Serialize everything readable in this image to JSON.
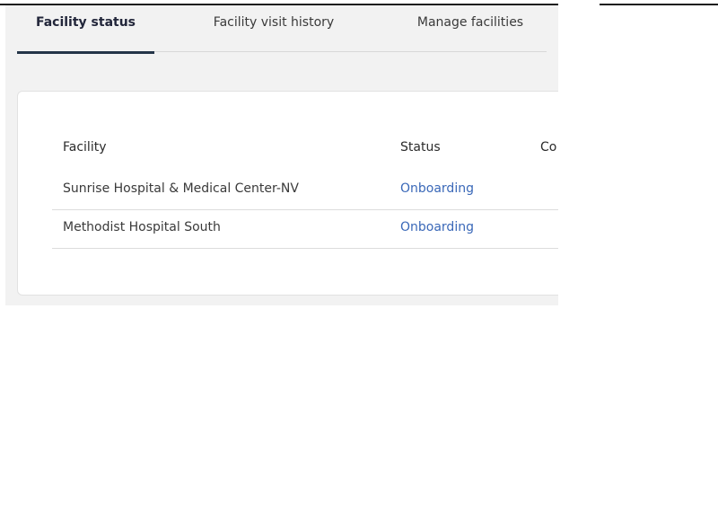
{
  "tabs": [
    {
      "label": "Facility status",
      "active": true
    },
    {
      "label": "Facility visit history",
      "active": false
    },
    {
      "label": "Manage facilities",
      "active": false
    }
  ],
  "table": {
    "columns": [
      "Facility",
      "Status",
      "Co"
    ],
    "rows": [
      {
        "facility": "Sunrise Hospital & Medical Center-NV",
        "status": "Onboarding"
      },
      {
        "facility": "Methodist Hospital South",
        "status": "Onboarding"
      }
    ]
  },
  "colors": {
    "accent_underline": "#243548",
    "status_link": "#3a68b8",
    "panel_background": "#f2f2f2"
  }
}
